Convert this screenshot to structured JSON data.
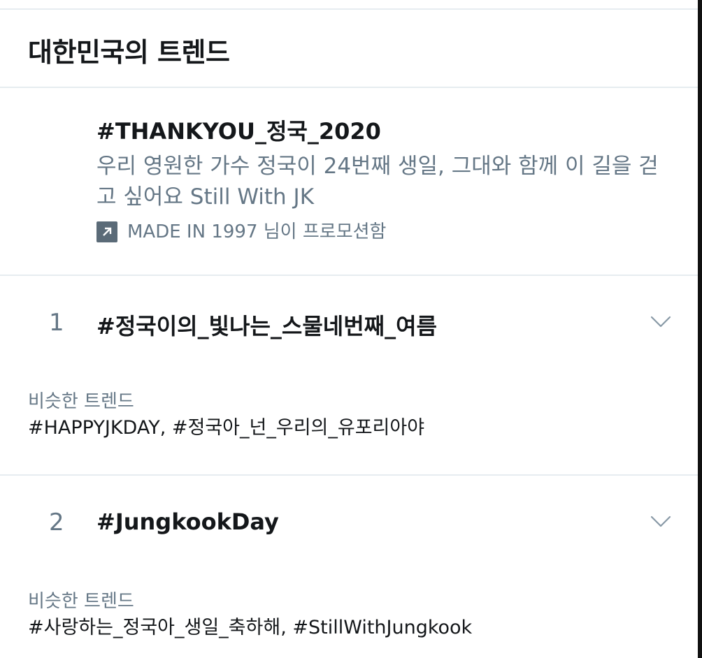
{
  "header": {
    "title": "대한민국의 트렌드"
  },
  "promoted": {
    "title": "#THANKYOU_정국_2020",
    "description": "우리 영원한 가수 정국이 24번째 생일, 그대와 함께 이 길을 걷고 싶어요 Still With JK",
    "promoted_by": "MADE IN 1997 님이 프로모션함",
    "icon": "promoted-arrow-icon"
  },
  "trends": [
    {
      "rank": "1",
      "name": "#정국이의_빛나는_스물네번째_여름",
      "similar_label": "비슷한 트렌드",
      "similar_values": "#HAPPYJKDAY, #정국아_넌_우리의_유포리아야"
    },
    {
      "rank": "2",
      "name": "#JungkookDay",
      "similar_label": "비슷한 트렌드",
      "similar_values": "#사랑하는_정국아_생일_축하해, #StillWithJungkook"
    }
  ],
  "colors": {
    "primary_text": "#14171a",
    "secondary_text": "#657786",
    "divider": "#e6ecf0",
    "chevron": "#8899a6"
  }
}
